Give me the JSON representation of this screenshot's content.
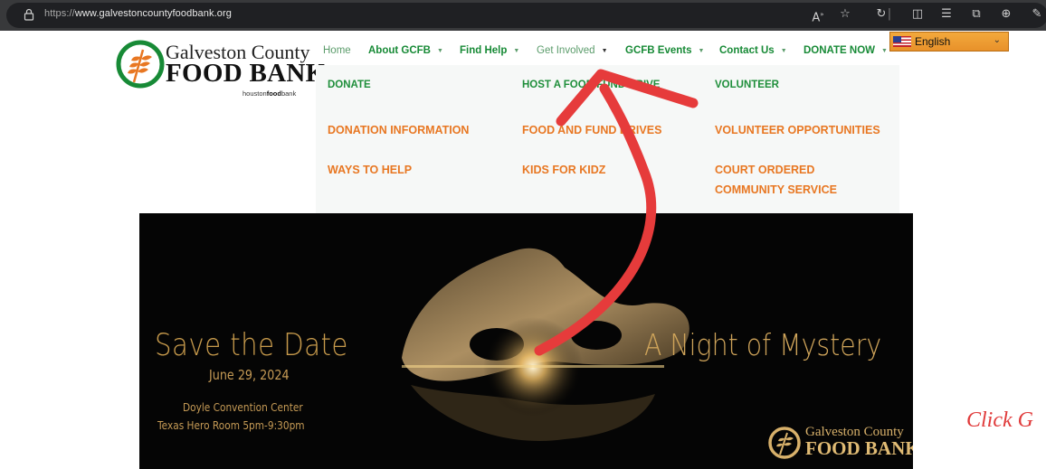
{
  "browser": {
    "url_scheme": "https://",
    "url_host": "www.galvestoncountyfoodbank.org",
    "icons": [
      "lock-icon",
      "read-aloud-icon",
      "favorite-star-icon",
      "refresh-icon",
      "split-screen-icon",
      "favorites-list-icon",
      "collections-icon",
      "download-icon",
      "extensions-icon"
    ]
  },
  "logo": {
    "line1": "Galveston County",
    "line2": "FOOD BANK",
    "partner_prefix": "houston",
    "partner_bold": "food",
    "partner_suffix": "bank"
  },
  "nav": {
    "items": [
      {
        "label": "Home"
      },
      {
        "label": "About GCFB"
      },
      {
        "label": "Find Help"
      },
      {
        "label": "Get Involved"
      },
      {
        "label": "GCFB Events"
      },
      {
        "label": "Contact Us"
      },
      {
        "label": "DONATE NOW"
      }
    ],
    "active": "Get Involved"
  },
  "language": {
    "selected": "English"
  },
  "dropdown": {
    "columns": [
      {
        "heading": "DONATE",
        "links": [
          "DONATION INFORMATION",
          "WAYS TO HELP"
        ]
      },
      {
        "heading": "HOST A FOOD/FUND DRIVE",
        "links": [
          "FOOD AND FUND DRIVES",
          "KIDS FOR KIDZ"
        ]
      },
      {
        "heading": "VOLUNTEER",
        "links": [
          "VOLUNTEER OPPORTUNITIES",
          "COURT ORDERED",
          "COMMUNITY SERVICE"
        ]
      }
    ]
  },
  "banner": {
    "headline": "Save the Date",
    "date": "June 29, 2024",
    "venue_line1": "Doyle Convention Center",
    "venue_line2": "Texas Hero Room 5pm-9:30pm",
    "event_name": "A Night of Mystery",
    "logo_line1": "Galveston County",
    "logo_line2": "FOOD BANK"
  },
  "annotation": {
    "text": "Click G",
    "color": "#e03a3a"
  },
  "colors": {
    "brand_green": "#178a36",
    "accent_orange": "#e87722",
    "banner_gold": "#c89b4c"
  }
}
